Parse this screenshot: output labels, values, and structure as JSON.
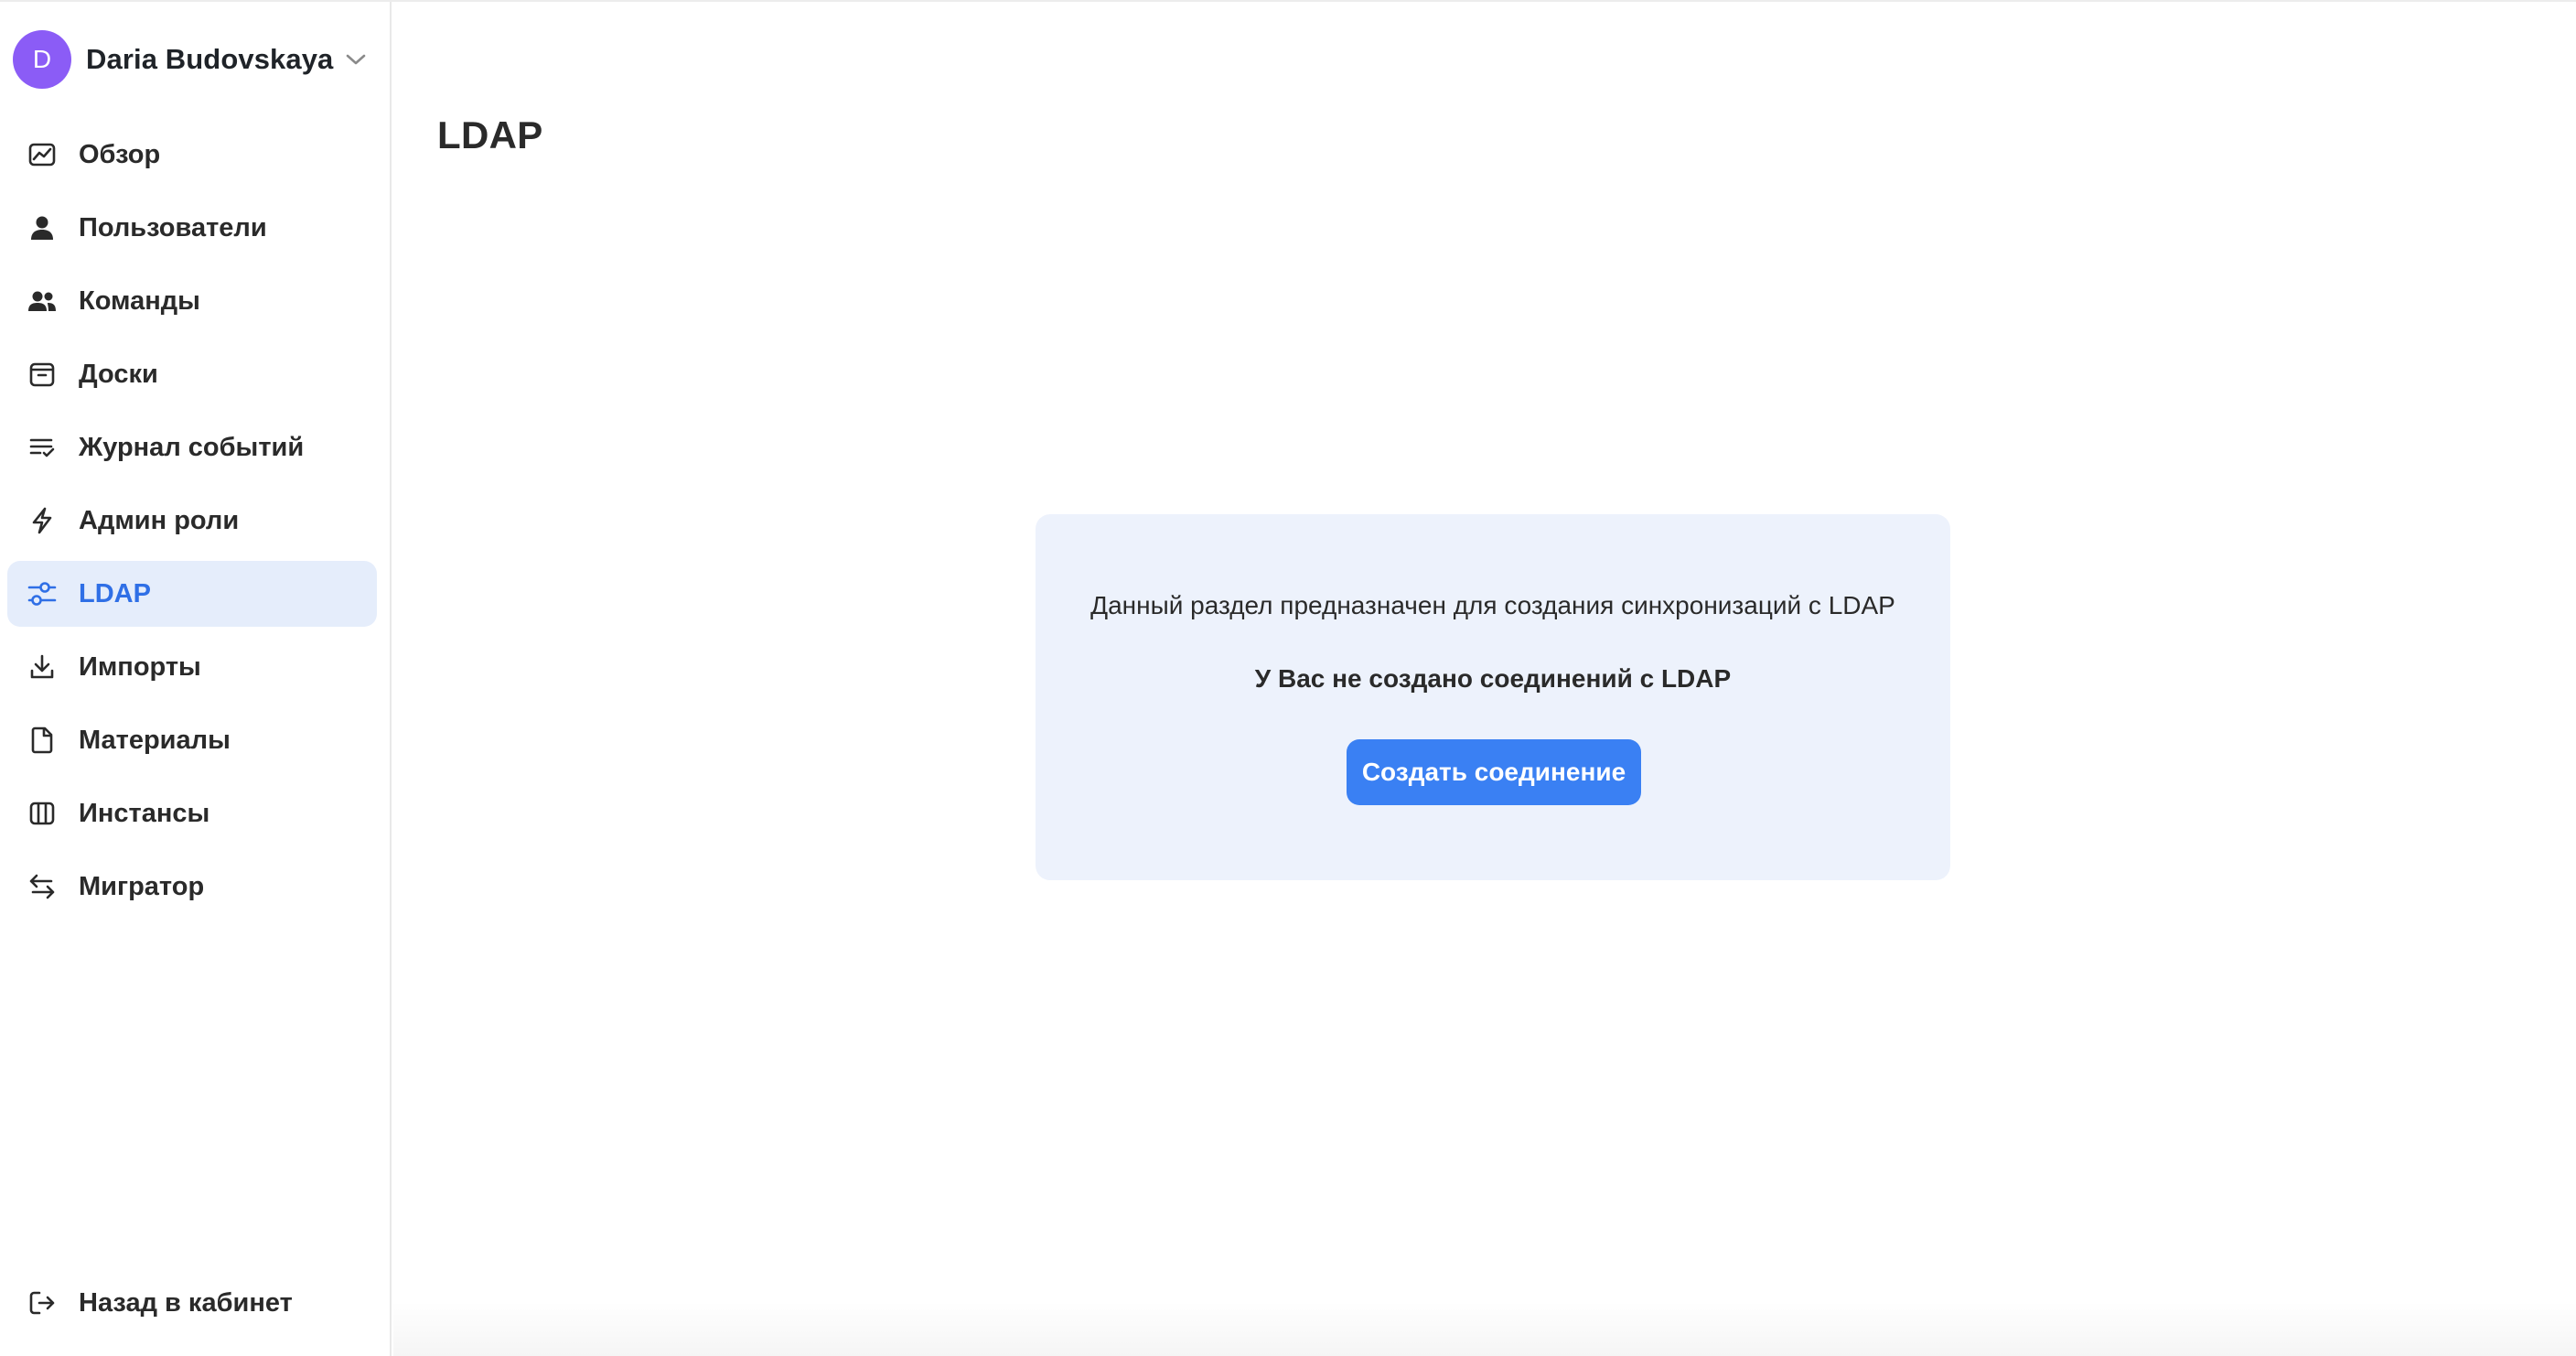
{
  "user": {
    "initial": "D",
    "name": "Daria Budovskaya",
    "avatar_color": "#8b5cf6"
  },
  "nav": {
    "items": [
      {
        "label": "Обзор",
        "icon": "chart-icon"
      },
      {
        "label": "Пользователи",
        "icon": "user-icon"
      },
      {
        "label": "Команды",
        "icon": "users-icon"
      },
      {
        "label": "Доски",
        "icon": "board-icon"
      },
      {
        "label": "Журнал событий",
        "icon": "event-log-icon"
      },
      {
        "label": "Админ роли",
        "icon": "bolt-icon"
      },
      {
        "label": "LDAP",
        "icon": "sliders-icon",
        "active": true
      },
      {
        "label": "Импорты",
        "icon": "download-icon"
      },
      {
        "label": "Материалы",
        "icon": "file-icon"
      },
      {
        "label": "Инстансы",
        "icon": "columns-icon"
      },
      {
        "label": "Мигратор",
        "icon": "swap-icon"
      }
    ],
    "back_label": "Назад в кабинет"
  },
  "main": {
    "title": "LDAP",
    "card": {
      "description": "Данный раздел предназначен для создания синхронизаций с LDAP",
      "empty_state": "У Вас не создано соединений с LDAP",
      "button_label": "Создать соединение"
    }
  },
  "colors": {
    "accent": "#3a80f3",
    "active_bg": "#e5edfb",
    "card_bg": "#edf2fc"
  }
}
